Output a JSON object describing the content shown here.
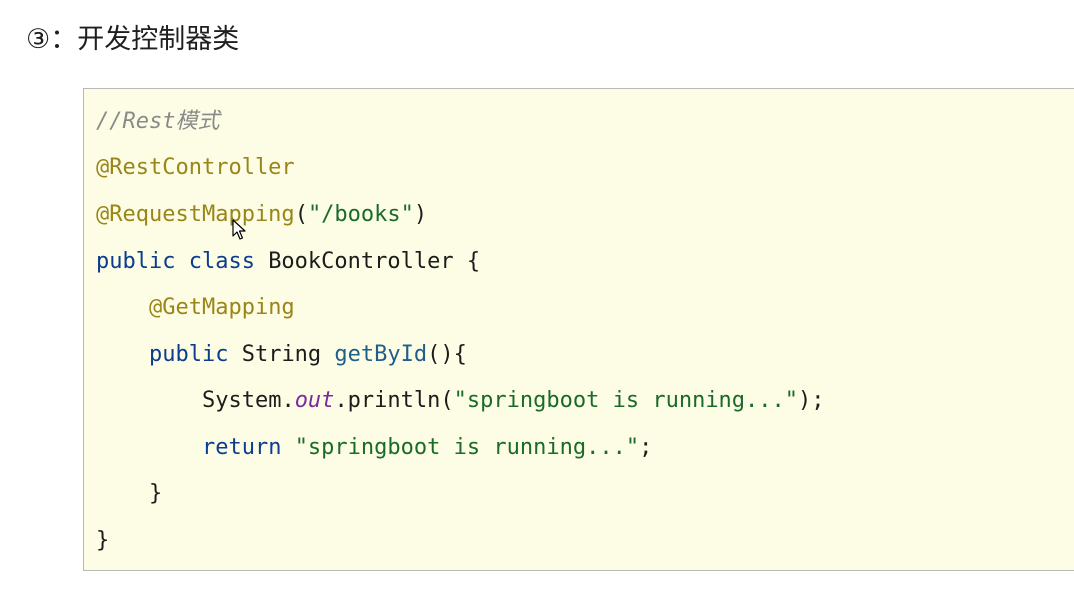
{
  "heading": {
    "text": "③：开发控制器类"
  },
  "code": {
    "lines": [
      {
        "indent": "",
        "tokens": [
          {
            "type": "comment",
            "text": "//Rest模式"
          }
        ]
      },
      {
        "indent": "",
        "tokens": [
          {
            "type": "annotation",
            "text": "@RestController"
          }
        ]
      },
      {
        "indent": "",
        "tokens": [
          {
            "type": "annotation",
            "text": "@RequestMapping"
          },
          {
            "type": "plain",
            "text": "("
          },
          {
            "type": "string",
            "text": "\"/books\""
          },
          {
            "type": "plain",
            "text": ")"
          }
        ]
      },
      {
        "indent": "",
        "tokens": [
          {
            "type": "keyword",
            "text": "public class "
          },
          {
            "type": "plain",
            "text": "BookController {"
          }
        ]
      },
      {
        "indent": "    ",
        "tokens": [
          {
            "type": "annotation",
            "text": "@GetMapping"
          }
        ]
      },
      {
        "indent": "    ",
        "tokens": [
          {
            "type": "keyword",
            "text": "public "
          },
          {
            "type": "plain",
            "text": "String "
          },
          {
            "type": "method",
            "text": "getById"
          },
          {
            "type": "plain",
            "text": "(){"
          }
        ]
      },
      {
        "indent": "        ",
        "tokens": [
          {
            "type": "plain",
            "text": "System."
          },
          {
            "type": "field",
            "text": "out"
          },
          {
            "type": "plain",
            "text": ".println("
          },
          {
            "type": "string",
            "text": "\"springboot is running...\""
          },
          {
            "type": "plain",
            "text": ");"
          }
        ]
      },
      {
        "indent": "        ",
        "tokens": [
          {
            "type": "keyword",
            "text": "return "
          },
          {
            "type": "string",
            "text": "\"springboot is running...\""
          },
          {
            "type": "plain",
            "text": ";"
          }
        ]
      },
      {
        "indent": "    ",
        "tokens": [
          {
            "type": "plain",
            "text": "}"
          }
        ]
      },
      {
        "indent": "",
        "tokens": [
          {
            "type": "plain",
            "text": "}"
          }
        ]
      }
    ]
  },
  "colors": {
    "code_background": "#fdfde5",
    "comment": "#8a8a8a",
    "annotation": "#9a8618",
    "keyword": "#0b3c8f",
    "string": "#1a6b2a",
    "field": "#7b2a9c"
  },
  "cursor": {
    "icon": "mouse-pointer-icon"
  }
}
